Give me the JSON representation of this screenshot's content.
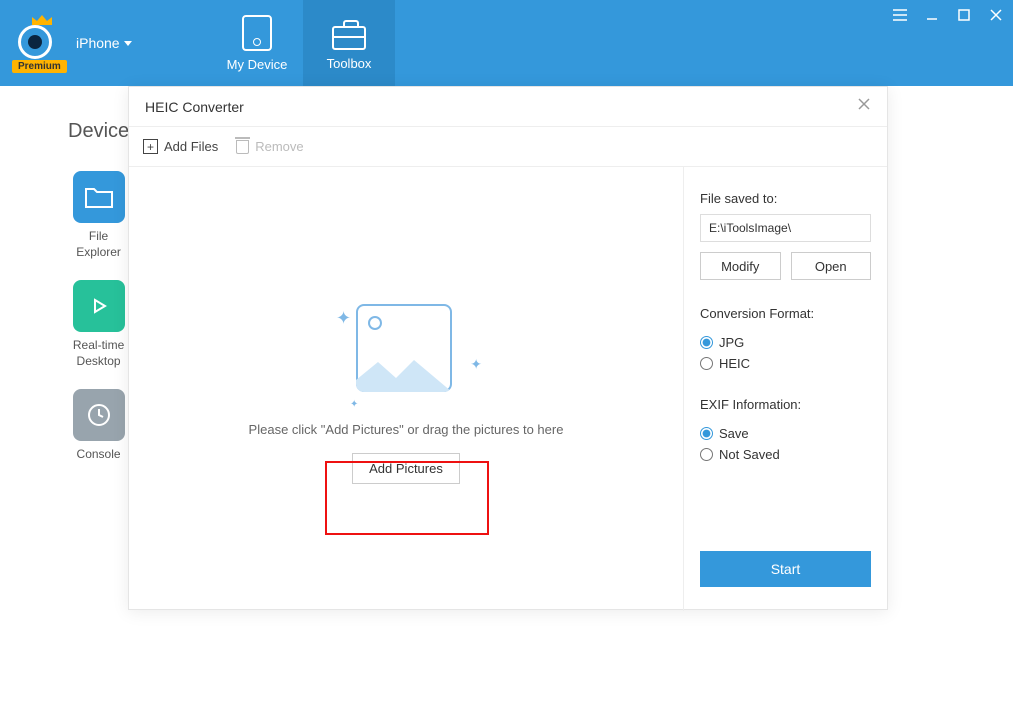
{
  "header": {
    "device_label": "iPhone",
    "premium_badge": "Premium",
    "tabs": [
      {
        "label": "My Device"
      },
      {
        "label": "Toolbox"
      }
    ]
  },
  "background": {
    "section_title": "Device",
    "tiles": [
      {
        "label": "File\nExplorer"
      },
      {
        "label": "Real-time\nDesktop"
      },
      {
        "label": "Console"
      }
    ]
  },
  "modal": {
    "title": "HEIC Converter",
    "toolbar": {
      "add_files": "Add Files",
      "remove": "Remove"
    },
    "drop": {
      "instruction": "Please click \"Add Pictures\" or drag the pictures to here",
      "button": "Add Pictures"
    },
    "side": {
      "saved_to_label": "File saved to:",
      "saved_to_path": "E:\\iToolsImage\\",
      "modify": "Modify",
      "open": "Open",
      "format_label": "Conversion Format:",
      "format_options": [
        {
          "label": "JPG",
          "checked": true
        },
        {
          "label": "HEIC",
          "checked": false
        }
      ],
      "exif_label": "EXIF Information:",
      "exif_options": [
        {
          "label": "Save",
          "checked": true
        },
        {
          "label": "Not Saved",
          "checked": false
        }
      ],
      "start": "Start"
    }
  }
}
